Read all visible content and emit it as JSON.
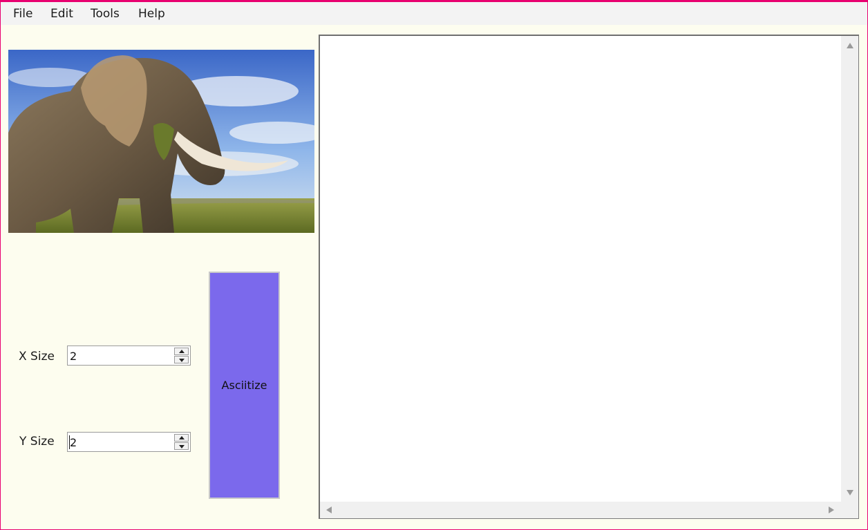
{
  "menu": {
    "file": "File",
    "edit": "Edit",
    "tools": "Tools",
    "help": "Help"
  },
  "image": {
    "icon": "elephant-photo"
  },
  "controls": {
    "x_label": "X Size",
    "x_value": "2",
    "y_label": "Y Size",
    "y_value": "2",
    "button_label": "Asciitize"
  },
  "output": {
    "text": ""
  },
  "colors": {
    "accent_border": "#e8006f",
    "button_fill": "#7b69ec",
    "background": "#fdfdef"
  }
}
